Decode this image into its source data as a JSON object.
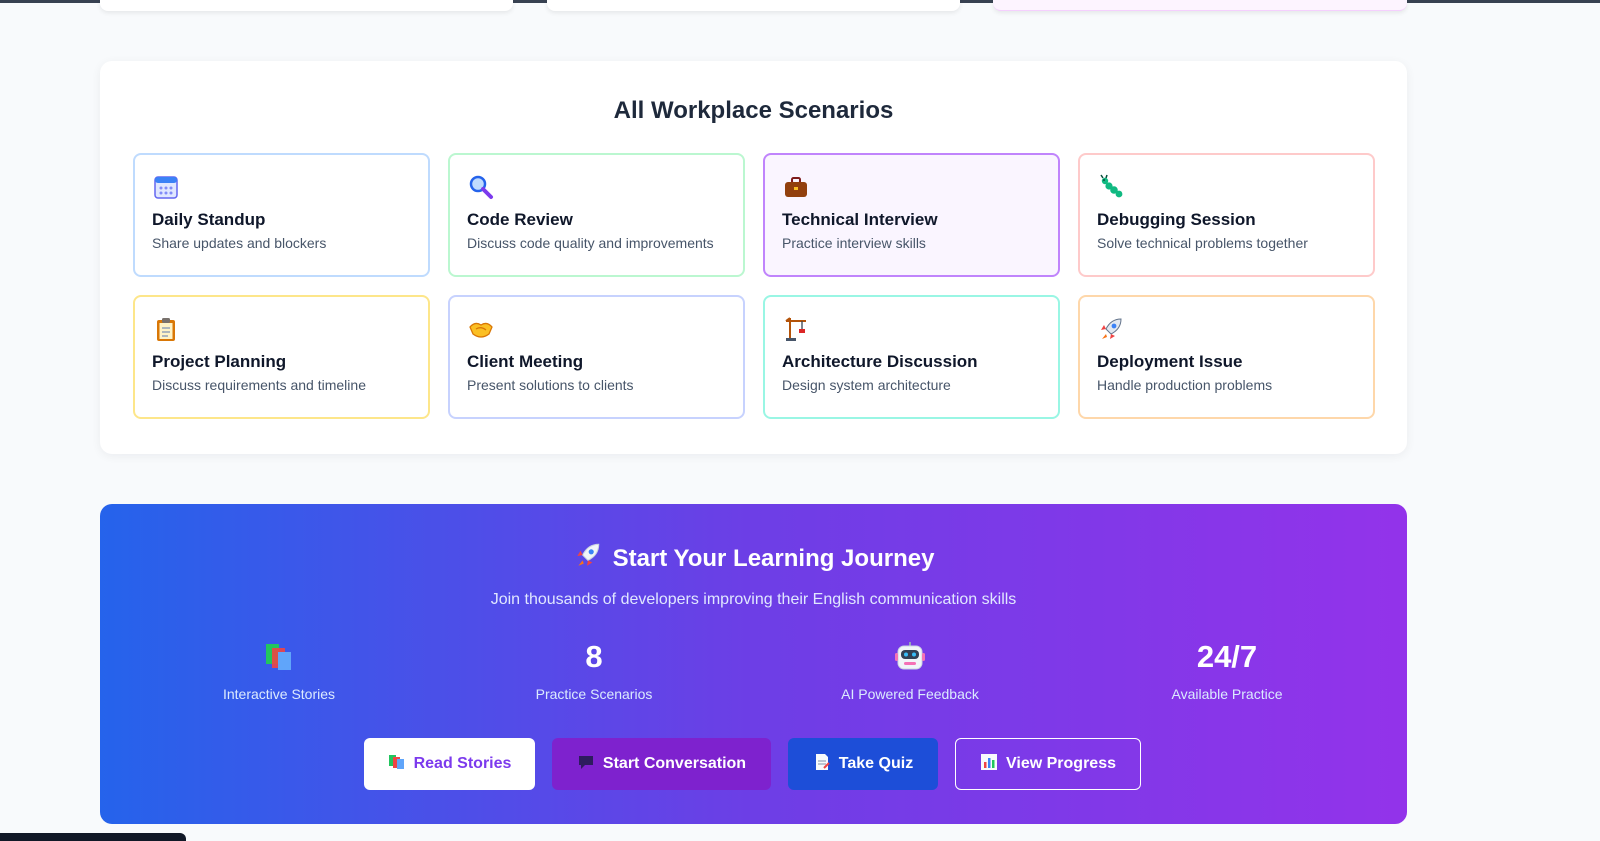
{
  "scenarios_section": {
    "title": "All Workplace Scenarios",
    "items": [
      {
        "icon": "calendar-icon",
        "title": "Daily Standup",
        "desc": "Share updates and blockers",
        "border": "#bfdbfe",
        "bg": "#ffffff"
      },
      {
        "icon": "magnifier-icon",
        "title": "Code Review",
        "desc": "Discuss code quality and improvements",
        "border": "#bbf7d0",
        "bg": "#ffffff"
      },
      {
        "icon": "briefcase-icon",
        "title": "Technical Interview",
        "desc": "Practice interview skills",
        "border": "#c084fc",
        "bg": "#faf5ff"
      },
      {
        "icon": "bug-icon",
        "title": "Debugging Session",
        "desc": "Solve technical problems together",
        "border": "#fecaca",
        "bg": "#ffffff"
      },
      {
        "icon": "clipboard-icon",
        "title": "Project Planning",
        "desc": "Discuss requirements and timeline",
        "border": "#fde68a",
        "bg": "#ffffff"
      },
      {
        "icon": "handshake-icon",
        "title": "Client Meeting",
        "desc": "Present solutions to clients",
        "border": "#c7d2fe",
        "bg": "#ffffff"
      },
      {
        "icon": "crane-icon",
        "title": "Architecture Discussion",
        "desc": "Design system architecture",
        "border": "#99f6e4",
        "bg": "#ffffff"
      },
      {
        "icon": "rocket-icon",
        "title": "Deployment Issue",
        "desc": "Handle production problems",
        "border": "#fed7aa",
        "bg": "#ffffff"
      }
    ]
  },
  "hero": {
    "title": "Start Your Learning Journey",
    "title_icon": "rocket-icon",
    "subtitle": "Join thousands of developers improving their English communication skills",
    "stats": [
      {
        "value": "",
        "icon": "books-icon",
        "label": "Interactive Stories"
      },
      {
        "value": "8",
        "label": "Practice Scenarios"
      },
      {
        "value": "",
        "icon": "robot-icon",
        "label": "AI Powered Feedback"
      },
      {
        "value": "24/7",
        "label": "Available Practice"
      }
    ],
    "buttons": [
      {
        "label": "Read Stories",
        "icon": "books-icon"
      },
      {
        "label": "Start Conversation",
        "icon": "speech-icon"
      },
      {
        "label": "Take Quiz",
        "icon": "quiz-icon"
      },
      {
        "label": "View Progress",
        "icon": "chart-icon"
      }
    ]
  },
  "colors": {
    "gradient_start": "#2563eb",
    "gradient_end": "#9333ea",
    "page_bg": "#f8fafc"
  }
}
